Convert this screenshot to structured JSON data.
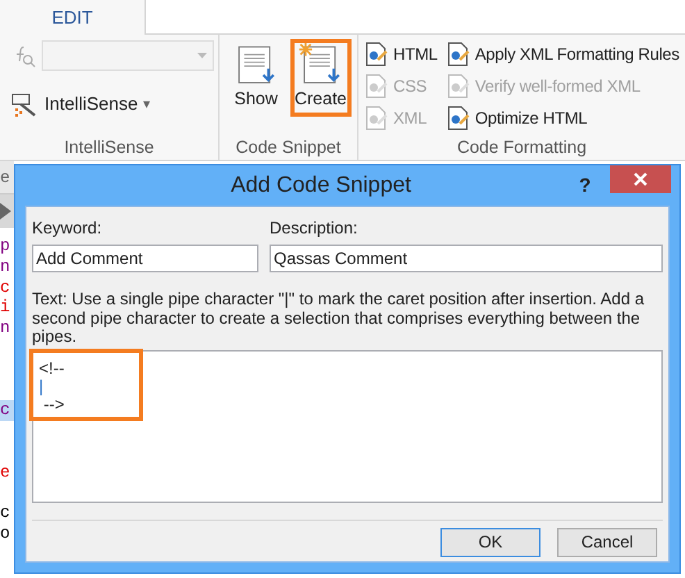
{
  "ribbon": {
    "tabs": [
      {
        "label": "EDIT",
        "selected": true
      }
    ],
    "groups": [
      {
        "kind": "intellisense",
        "label": "IntelliSense",
        "combo": {
          "disabled": true
        },
        "button": {
          "label": "IntelliSense",
          "dropdown": "▾"
        }
      },
      {
        "kind": "snippet",
        "label": "Code Snippet",
        "buttons": [
          {
            "label": "Show",
            "highlighted": false,
            "starburst": false
          },
          {
            "label": "Create",
            "highlighted": true,
            "starburst": true
          }
        ]
      },
      {
        "kind": "formatting",
        "label": "Code Formatting",
        "columns": [
          [
            {
              "label": "HTML",
              "disabled": false
            },
            {
              "label": "CSS",
              "disabled": true
            },
            {
              "label": "XML",
              "disabled": true
            }
          ],
          [
            {
              "label": "Apply XML Formatting Rules",
              "disabled": false
            },
            {
              "label": "Verify well-formed XML",
              "disabled": true
            },
            {
              "label": "Optimize HTML",
              "disabled": false
            }
          ]
        ]
      }
    ]
  },
  "editor": {
    "header": "e",
    "lines": [
      {
        "kind": "text",
        "text": "p",
        "color": "#800080",
        "selected": false
      },
      {
        "kind": "text",
        "text": "n",
        "color": "#800080",
        "selected": false
      },
      {
        "kind": "text",
        "text": "c",
        "color": "#e00000",
        "selected": false
      },
      {
        "kind": "text",
        "text": "i",
        "color": "#e00000",
        "selected": false
      },
      {
        "kind": "text",
        "text": "n",
        "color": "#800080",
        "selected": false
      },
      {
        "kind": "blank"
      },
      {
        "kind": "blank"
      },
      {
        "kind": "blank"
      },
      {
        "kind": "text",
        "text": "c",
        "color": "#800080",
        "selected": true
      },
      {
        "kind": "blank"
      },
      {
        "kind": "blank"
      },
      {
        "kind": "text",
        "text": "e",
        "color": "#e00000",
        "selected": false
      },
      {
        "kind": "blank"
      },
      {
        "kind": "text",
        "text": "c",
        "color": "#000000",
        "selected": false
      },
      {
        "kind": "text",
        "text": "o",
        "color": "#000000",
        "selected": false
      }
    ]
  },
  "dialog": {
    "title": "Add Code Snippet",
    "help": "?",
    "keyword": {
      "label": "Keyword:",
      "value": "Add Comment"
    },
    "description": {
      "label": "Description:",
      "value": "Qassas Comment"
    },
    "instructions": "Text: Use a single pipe character \"|\" to mark the caret position after insertion. Add a second pipe character to create a selection that comprises everything between the pipes.",
    "snippet": {
      "highlighted": true,
      "lines": [
        {
          "text": "<!--",
          "kind": "code"
        },
        {
          "text": "|",
          "kind": "caret"
        },
        {
          "text": " -->",
          "kind": "code"
        }
      ]
    },
    "buttons": [
      {
        "label": "OK",
        "default": true
      },
      {
        "label": "Cancel",
        "default": false
      }
    ]
  }
}
